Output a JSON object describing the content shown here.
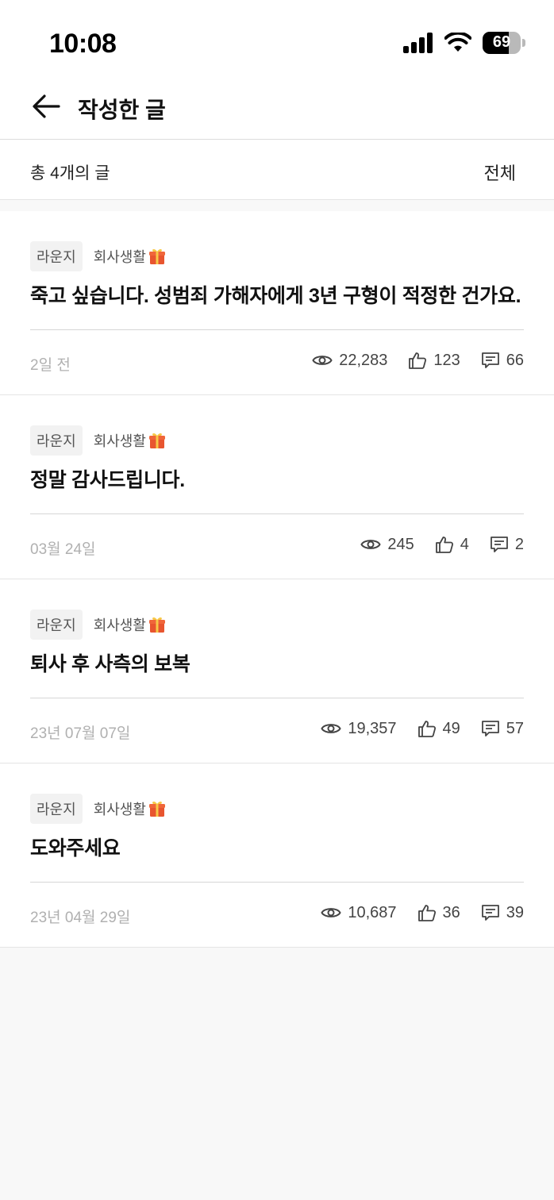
{
  "status_bar": {
    "time": "10:08",
    "battery": "69",
    "battery_level": 0.69
  },
  "header": {
    "title": "작성한 글"
  },
  "summary": {
    "count_text": "총 4개의 글",
    "filter_label": "전체"
  },
  "posts": [
    {
      "tag": "라운지",
      "category": "회사생활",
      "title": "죽고 싶습니다. 성범죄 가해자에게 3년 구형이 적정한 건가요.",
      "date": "2일 전",
      "views": "22,283",
      "likes": "123",
      "comments": "66"
    },
    {
      "tag": "라운지",
      "category": "회사생활",
      "title": "정말 감사드립니다.",
      "date": "03월 24일",
      "views": "245",
      "likes": "4",
      "comments": "2"
    },
    {
      "tag": "라운지",
      "category": "회사생활",
      "title": "퇴사 후 사측의 보복",
      "date": "23년 07월 07일",
      "views": "19,357",
      "likes": "49",
      "comments": "57"
    },
    {
      "tag": "라운지",
      "category": "회사생활",
      "title": "도와주세요",
      "date": "23년 04월 29일",
      "views": "10,687",
      "likes": "36",
      "comments": "39"
    }
  ],
  "icons": {
    "back": "arrow-left-icon",
    "views": "eye-icon",
    "likes": "thumbs-up-icon",
    "comments": "comment-icon",
    "category": "gift-icon"
  }
}
